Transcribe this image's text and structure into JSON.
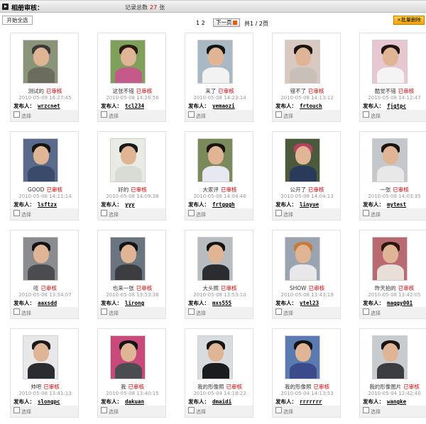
{
  "header": {
    "title": "相册审核：",
    "total_label_prefix": "记录总数",
    "total_count": "27",
    "total_label_suffix": "张"
  },
  "toolbar": {
    "select_all_label": "开始全选",
    "pages": "1 2",
    "next_label": "下一页",
    "page_info": "共1 / 2页",
    "batch_delete_label": "×批量删除"
  },
  "common": {
    "status": "已审核",
    "poster_label": "发布人：",
    "select_label": "选择"
  },
  "cards": [
    {
      "caption": "测试的",
      "date": "2010-05-09 16:27:45",
      "user": "wrzcnet"
    },
    {
      "caption": "这张不错",
      "date": "2010-05-08 14:26:56",
      "user": "tcl234"
    },
    {
      "caption": "来了",
      "date": "2010-05-08 14:23:14",
      "user": "yemaozi"
    },
    {
      "caption": "错不了",
      "date": "2010-05-08 14:13:12",
      "user": "frtouch"
    },
    {
      "caption": "酷觉不错",
      "date": "2010-05-08 14:12:47",
      "user": "fjgtpc"
    },
    {
      "caption": "GOOD",
      "date": "2010-05-08 14:11:14",
      "user": "lsftzx"
    },
    {
      "caption": "好的",
      "date": "2010-05-08 14:09:38",
      "user": "yyy"
    },
    {
      "caption": "大家评",
      "date": "2010-05-08 14:04:46",
      "user": "frtgggh"
    },
    {
      "caption": "公开了",
      "date": "2010-05-08 14:04:13",
      "user": "linyue"
    },
    {
      "caption": "一张",
      "date": "2010-05-08 14:03:35",
      "user": "mytest"
    },
    {
      "caption": "哇",
      "date": "2010-05-08 13:54:07",
      "user": "aaxsdd"
    },
    {
      "caption": "也来一张",
      "date": "2010-05-08 13:53:38",
      "user": "lirong"
    },
    {
      "caption": "大头照",
      "date": "2010-05-08 13:53:10",
      "user": "mxs555"
    },
    {
      "caption": "SHOW",
      "date": "2010-05-08 13:43:19",
      "user": "ytel23"
    },
    {
      "caption": "昨天拍的",
      "date": "2010-05-08 13:42:05",
      "user": "maggy001"
    },
    {
      "caption": "帅吧",
      "date": "2010-05-08 13:41:13",
      "user": "slongpc"
    },
    {
      "caption": "我",
      "date": "2010-05-08 13:40:15",
      "user": "dakuan"
    },
    {
      "caption": "我的形像照",
      "date": "2010-05-04 14:18:22",
      "user": "dmaidi"
    },
    {
      "caption": "我的形像照",
      "date": "2010-05-04 14:13:53",
      "user": "rrrrrrr"
    },
    {
      "caption": "我的形像图片",
      "date": "2010-05-04 12:42:40",
      "user": "wangke"
    }
  ],
  "photo_colors": [
    {
      "bg": "#8a9478",
      "body": "#6b6b5e",
      "hair": "#3a3a36"
    },
    {
      "bg": "#7fa05a",
      "body": "#c45a8a",
      "hair": "#2a1c14"
    },
    {
      "bg": "#a8b8c4",
      "body": "#f2f2f2",
      "hair": "#141414"
    },
    {
      "bg": "#d8c8c0",
      "body": "#c8c0b8",
      "hair": "#1a1412"
    },
    {
      "bg": "#e8c8d0",
      "body": "#f4f4f4",
      "hair": "#1e1410"
    },
    {
      "bg": "#5a6a8a",
      "body": "#3a4a6a",
      "hair": "#141414"
    },
    {
      "bg": "#e8ece4",
      "body": "#d8dcd4",
      "hair": "#1a1a1a"
    },
    {
      "bg": "#7a8a5a",
      "body": "#e8e8f0",
      "hair": "#1a1410"
    },
    {
      "bg": "#4a5a3a",
      "body": "#2a3a5a",
      "hair": "#b84060"
    },
    {
      "bg": "#c4c8cc",
      "body": "#e8e8e8",
      "hair": "#1a1410"
    },
    {
      "bg": "#8a8c90",
      "body": "#4a4c50",
      "hair": "#141414"
    },
    {
      "bg": "#6a7480",
      "body": "#3a3c40",
      "hair": "#141414"
    },
    {
      "bg": "#b8bcc0",
      "body": "#2a2c30",
      "hair": "#141414"
    },
    {
      "bg": "#9aa4b0",
      "body": "#e8e8ea",
      "hair": "#c87a3a"
    },
    {
      "bg": "#b86a70",
      "body": "#e8e0d8",
      "hair": "#2a1810"
    },
    {
      "bg": "#e8e8ea",
      "body": "#2a2c30",
      "hair": "#1a1a1a"
    },
    {
      "bg": "#c84a7a",
      "body": "#4a4c50",
      "hair": "#141414"
    },
    {
      "bg": "#d8dce0",
      "body": "#1a1c20",
      "hair": "#141414"
    },
    {
      "bg": "#5a7ab0",
      "body": "#3a4a8a",
      "hair": "#141414"
    },
    {
      "bg": "#c8ccd0",
      "body": "#3a3c40",
      "hair": "#1a1410"
    }
  ]
}
